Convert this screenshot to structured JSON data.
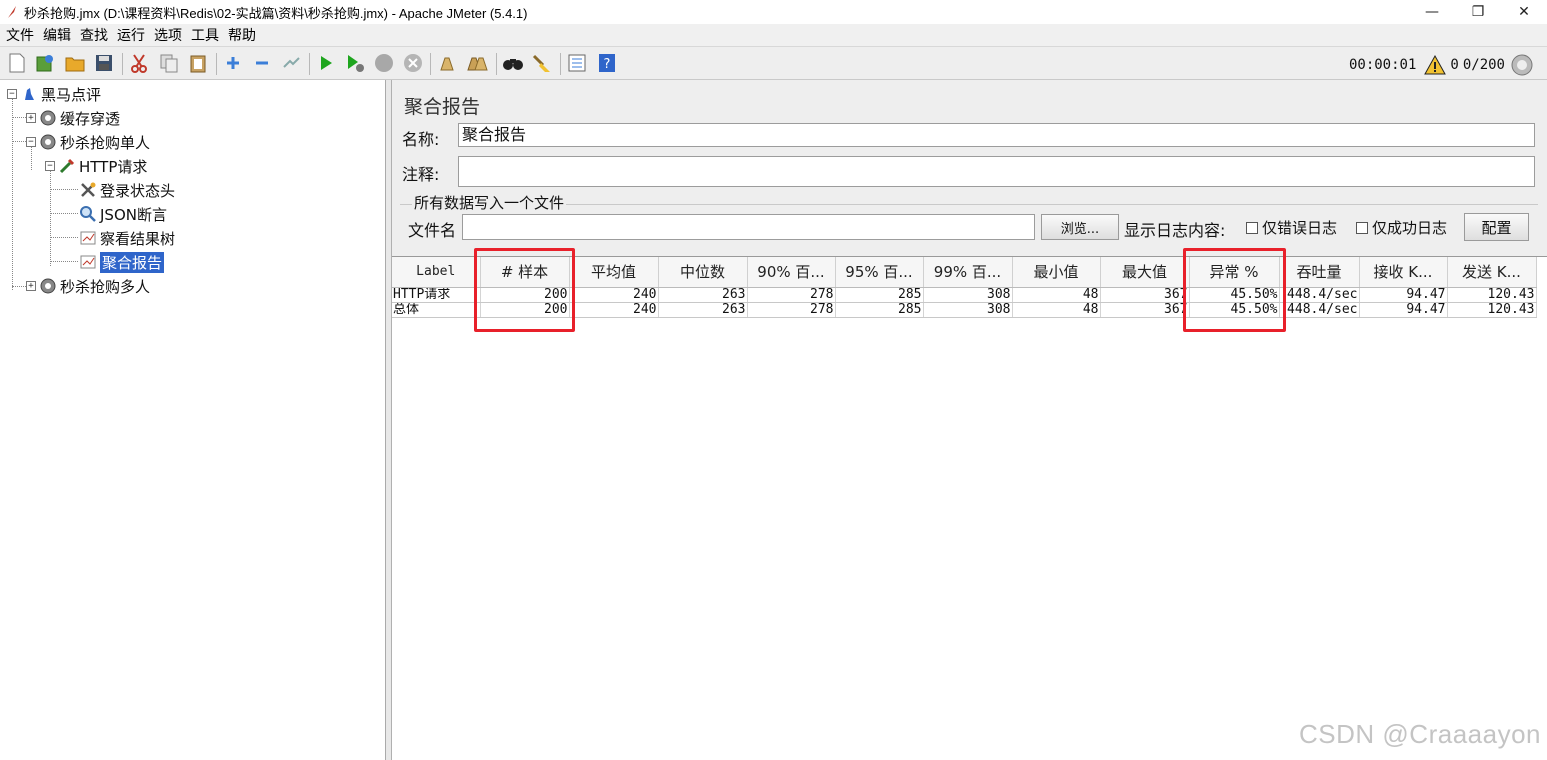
{
  "window": {
    "title": "秒杀抢购.jmx (D:\\课程资料\\Redis\\02-实战篇\\资料\\秒杀抢购.jmx) - Apache JMeter (5.4.1)",
    "controls": {
      "minimize": "—",
      "maximize": "❐",
      "close": "✕"
    }
  },
  "menu": [
    "文件",
    "编辑",
    "查找",
    "运行",
    "选项",
    "工具",
    "帮助"
  ],
  "toolbar": {
    "icons": [
      "new-icon",
      "templates-icon",
      "open-icon",
      "save-icon",
      "cut-icon",
      "copy-icon",
      "paste-icon",
      "expand-icon",
      "collapse-icon",
      "toggle-icon",
      "start-icon",
      "start-no-pause-icon",
      "stop-icon",
      "shutdown-icon",
      "clear-icon",
      "clear-all-icon",
      "search-icon",
      "reset-search-icon",
      "function-helper-icon",
      "help-icon"
    ],
    "timer": "00:00:01",
    "warning_count": "0",
    "threads": "0/200"
  },
  "tree": {
    "root": "黑马点评",
    "items": {
      "cache": "缓存穿透",
      "single": "秒杀抢购单人",
      "http": "HTTP请求",
      "header": "登录状态头",
      "json": "JSON断言",
      "results_tree": "察看结果树",
      "aggregate": "聚合报告",
      "multi": "秒杀抢购多人"
    }
  },
  "panel": {
    "title": "聚合报告",
    "name_label": "名称:",
    "name_value": "聚合报告",
    "comment_label": "注释:",
    "comment_value": "",
    "file_group": "所有数据写入一个文件",
    "filename_label": "文件名",
    "filename_value": "",
    "browse": "浏览...",
    "log_label": "显示日志内容:",
    "errors_only": "仅错误日志",
    "success_only": "仅成功日志",
    "configure": "配置"
  },
  "table": {
    "headers": [
      "Label",
      "# 样本",
      "平均值",
      "中位数",
      "90% 百...",
      "95% 百...",
      "99% 百...",
      "最小值",
      "最大值",
      "异常 %",
      "吞吐量",
      "接收 K...",
      "发送 K..."
    ],
    "rows": [
      [
        "HTTP请求",
        "200",
        "240",
        "263",
        "278",
        "285",
        "308",
        "48",
        "367",
        "45.50%",
        "448.4/sec",
        "94.47",
        "120.43"
      ],
      [
        "总体",
        "200",
        "240",
        "263",
        "278",
        "285",
        "308",
        "48",
        "367",
        "45.50%",
        "448.4/sec",
        "94.47",
        "120.43"
      ]
    ]
  },
  "watermark": "CSDN @Craaaayon",
  "colors": {
    "selection": "#2f65ca",
    "highlight": "#e8202a",
    "play": "#1ea51e"
  }
}
